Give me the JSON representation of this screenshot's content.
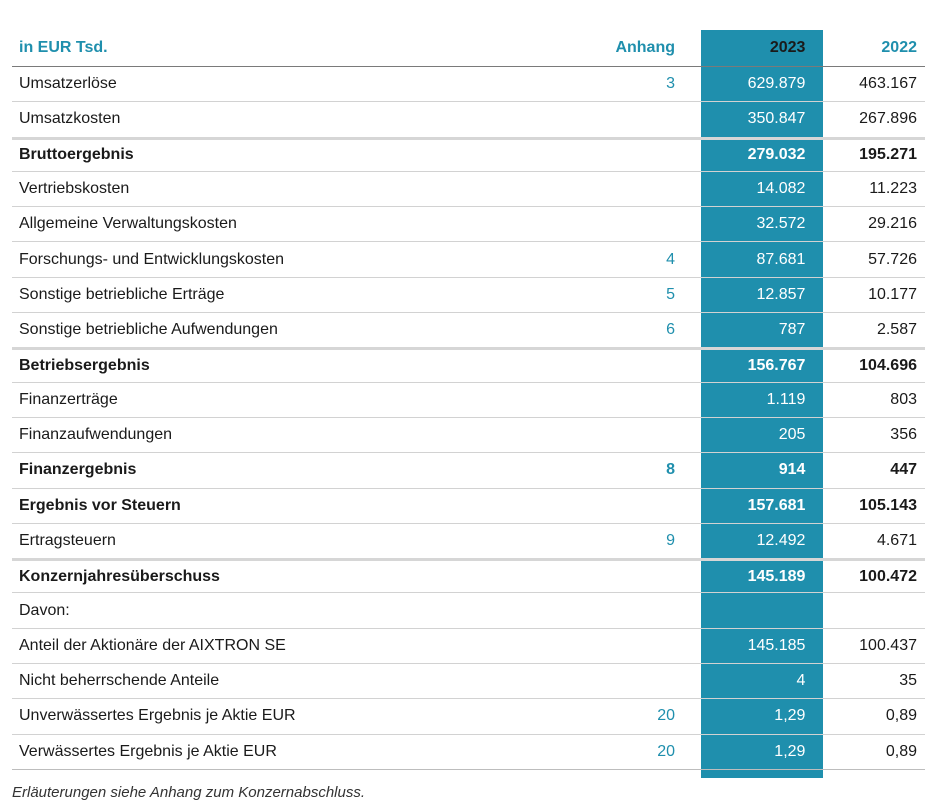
{
  "header": {
    "label": "in EUR Tsd.",
    "note": "Anhang",
    "year_current": "2023",
    "year_prior": "2022"
  },
  "rows": [
    {
      "label": "Umsatzerlöse",
      "note": "3",
      "v2023": "629.879",
      "v2022": "463.167",
      "bold": false,
      "sub": false
    },
    {
      "label": "Umsatzkosten",
      "note": "",
      "v2023": "350.847",
      "v2022": "267.896",
      "bold": false,
      "sub": false
    },
    {
      "label": "Bruttoergebnis",
      "note": "",
      "v2023": "279.032",
      "v2022": "195.271",
      "bold": true,
      "sub": true
    },
    {
      "label": "Vertriebskosten",
      "note": "",
      "v2023": "14.082",
      "v2022": "11.223",
      "bold": false,
      "sub": false
    },
    {
      "label": "Allgemeine Verwaltungskosten",
      "note": "",
      "v2023": "32.572",
      "v2022": "29.216",
      "bold": false,
      "sub": false
    },
    {
      "label": "Forschungs- und Entwicklungskosten",
      "note": "4",
      "v2023": "87.681",
      "v2022": "57.726",
      "bold": false,
      "sub": false
    },
    {
      "label": "Sonstige betriebliche Erträge",
      "note": "5",
      "v2023": "12.857",
      "v2022": "10.177",
      "bold": false,
      "sub": false
    },
    {
      "label": "Sonstige betriebliche Aufwendungen",
      "note": "6",
      "v2023": "787",
      "v2022": "2.587",
      "bold": false,
      "sub": false
    },
    {
      "label": "Betriebsergebnis",
      "note": "",
      "v2023": "156.767",
      "v2022": "104.696",
      "bold": true,
      "sub": true
    },
    {
      "label": "Finanzerträge",
      "note": "",
      "v2023": "1.119",
      "v2022": "803",
      "bold": false,
      "sub": false
    },
    {
      "label": "Finanzaufwendungen",
      "note": "",
      "v2023": "205",
      "v2022": "356",
      "bold": false,
      "sub": false
    },
    {
      "label": "Finanzergebnis",
      "note": "8",
      "v2023": "914",
      "v2022": "447",
      "bold": true,
      "sub": false
    },
    {
      "label": "Ergebnis vor Steuern",
      "note": "",
      "v2023": "157.681",
      "v2022": "105.143",
      "bold": true,
      "sub": false
    },
    {
      "label": "Ertragsteuern",
      "note": "9",
      "v2023": "12.492",
      "v2022": "4.671",
      "bold": false,
      "sub": false
    },
    {
      "label": "Konzernjahresüberschuss",
      "note": "",
      "v2023": "145.189",
      "v2022": "100.472",
      "bold": true,
      "sub": true
    },
    {
      "label": "Davon:",
      "note": "",
      "v2023": "",
      "v2022": "",
      "bold": false,
      "sub": false
    },
    {
      "label": "Anteil der Aktionäre der AIXTRON SE",
      "note": "",
      "v2023": "145.185",
      "v2022": "100.437",
      "bold": false,
      "sub": false
    },
    {
      "label": "Nicht beherrschende Anteile",
      "note": "",
      "v2023": "4",
      "v2022": "35",
      "bold": false,
      "sub": false
    },
    {
      "label": "Unverwässertes Ergebnis je Aktie EUR",
      "note": "20",
      "v2023": "1,29",
      "v2022": "0,89",
      "bold": false,
      "sub": false
    },
    {
      "label": "Verwässertes Ergebnis je Aktie EUR",
      "note": "20",
      "v2023": "1,29",
      "v2022": "0,89",
      "bold": false,
      "sub": false
    }
  ],
  "footnote": "Erläuterungen siehe Anhang zum Konzernabschluss.",
  "colors": {
    "accent": "#1f8fad",
    "highlight_text": "#ffffff",
    "rule": "#d2d2d2"
  }
}
